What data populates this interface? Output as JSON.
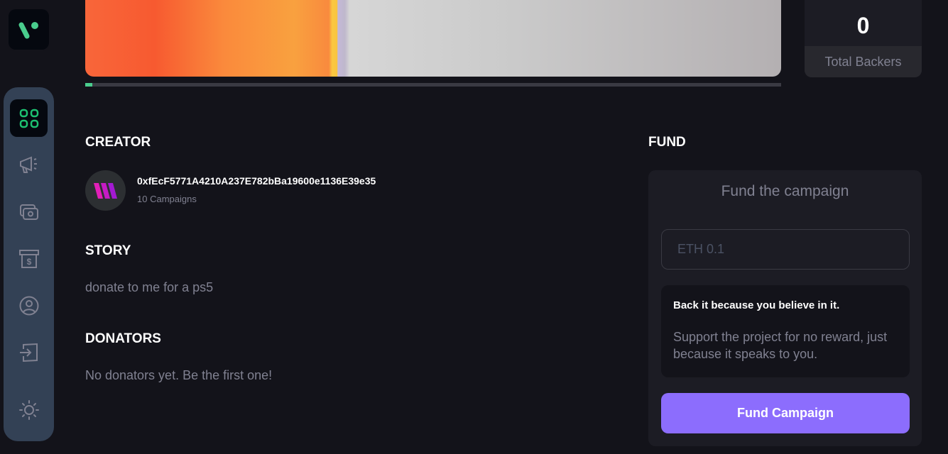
{
  "colors": {
    "accent": "#8c6dfd",
    "progress": "#4acd8d",
    "sidebar": "#334155",
    "background": "#13131a"
  },
  "sidebar": {
    "items": [
      {
        "icon": "dashboard-icon",
        "active": true
      },
      {
        "icon": "megaphone-icon"
      },
      {
        "icon": "payment-icon"
      },
      {
        "icon": "withdraw-icon"
      },
      {
        "icon": "profile-icon"
      },
      {
        "icon": "logout-icon"
      },
      {
        "icon": "sun-icon"
      }
    ]
  },
  "campaign": {
    "progress_percent": 1
  },
  "stats": {
    "backers_value": "0",
    "backers_label": "Total Backers"
  },
  "creator": {
    "heading": "CREATOR",
    "address": "0xfEcF5771A4210A237E782bBa19600e1136E39e35",
    "campaigns": "10 Campaigns"
  },
  "story": {
    "heading": "STORY",
    "text": "donate to me for a ps5"
  },
  "donators": {
    "heading": "DONATORS",
    "text": "No donators yet. Be the first one!"
  },
  "fund": {
    "heading": "FUND",
    "title": "Fund the campaign",
    "placeholder": "ETH 0.1",
    "info_title": "Back it because you believe in it.",
    "info_text": "Support the project for no reward, just because it speaks to you.",
    "button": "Fund Campaign"
  }
}
